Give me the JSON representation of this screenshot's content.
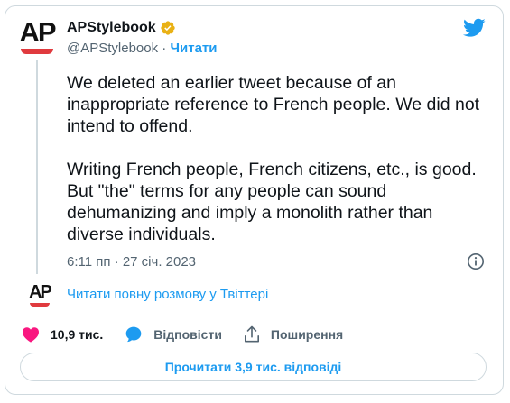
{
  "author": {
    "display_name": "APStylebook",
    "handle": "@APStylebook",
    "separator": "·",
    "follow_label": "Читати",
    "logo_text": "AP",
    "verified_color": "#e9b115"
  },
  "tweet": {
    "text": "We deleted an earlier tweet because of an inappropriate reference to French people. We did not intend to offend.\n\nWriting French people, French citizens, etc., is good. But \"the\" terms for any people can sound dehumanizing and imply a monolith rather than diverse individuals.",
    "timestamp": "6:11 пп · 27 січ. 2023"
  },
  "thread": {
    "logo_text": "AP",
    "read_conversation_label": "Читати повну розмову у Твіттері"
  },
  "actions": {
    "like_count": "10,9 тис.",
    "reply_label": "Відповісти",
    "share_label": "Поширення"
  },
  "replies_button_label": "Прочитати 3,9 тис. відповіді",
  "colors": {
    "accent": "#1d9bf0",
    "like": "#f91880",
    "ap_red": "#e03a3e",
    "secondary_text": "#536471",
    "border": "#cfd9de"
  },
  "icons": [
    "ap-logo-icon",
    "verified-badge-icon",
    "twitter-bird-icon",
    "info-icon",
    "heart-icon",
    "reply-bubble-icon",
    "share-icon"
  ]
}
